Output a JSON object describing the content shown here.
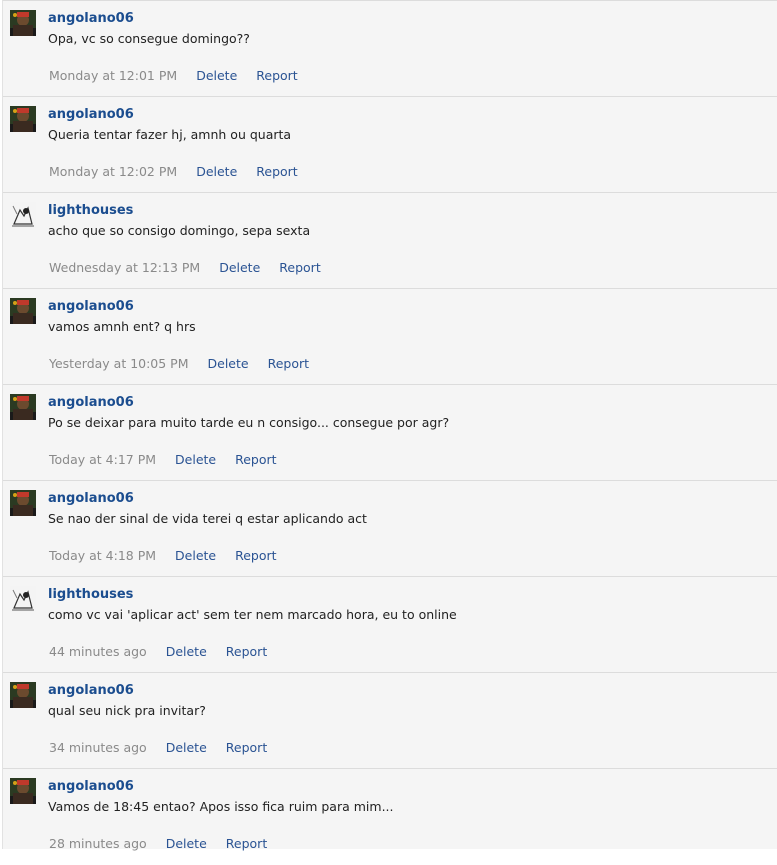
{
  "messages": [
    {
      "user": "angolano06",
      "avatar": "dark-character-avatar",
      "text": "Opa, vc so consegue domingo??",
      "time": "Monday at 12:01 PM",
      "delete": "Delete",
      "report": "Report"
    },
    {
      "user": "angolano06",
      "avatar": "dark-character-avatar",
      "text": "Queria tentar fazer hj, amnh ou quarta",
      "time": "Monday at 12:02 PM",
      "delete": "Delete",
      "report": "Report"
    },
    {
      "user": "lighthouses",
      "avatar": "sketch-avatar",
      "text": "acho que so consigo domingo, sepa sexta",
      "time": "Wednesday at 12:13 PM",
      "delete": "Delete",
      "report": "Report"
    },
    {
      "user": "angolano06",
      "avatar": "dark-character-avatar",
      "text": "vamos amnh ent? q hrs",
      "time": "Yesterday at 10:05 PM",
      "delete": "Delete",
      "report": "Report"
    },
    {
      "user": "angolano06",
      "avatar": "dark-character-avatar",
      "text": "Po se deixar para muito tarde eu n consigo... consegue por agr?",
      "time": "Today at 4:17 PM",
      "delete": "Delete",
      "report": "Report"
    },
    {
      "user": "angolano06",
      "avatar": "dark-character-avatar",
      "text": "Se nao der sinal de vida terei q estar aplicando act",
      "time": "Today at 4:18 PM",
      "delete": "Delete",
      "report": "Report"
    },
    {
      "user": "lighthouses",
      "avatar": "sketch-avatar",
      "text": "como vc vai 'aplicar act' sem ter nem marcado hora, eu to online",
      "time": "44 minutes ago",
      "delete": "Delete",
      "report": "Report"
    },
    {
      "user": "angolano06",
      "avatar": "dark-character-avatar",
      "text": "qual seu nick pra invitar?",
      "time": "34 minutes ago",
      "delete": "Delete",
      "report": "Report"
    },
    {
      "user": "angolano06",
      "avatar": "dark-character-avatar",
      "text": "Vamos de 18:45 entao? Apos isso fica ruim para mim...",
      "time": "28 minutes ago",
      "delete": "Delete",
      "report": "Report"
    }
  ],
  "colors": {
    "background": "#f5f5f5",
    "username": "#1b4d8f",
    "link": "#2a5393",
    "timestamp": "#8a8a8a",
    "divider": "#dcdcdc"
  }
}
